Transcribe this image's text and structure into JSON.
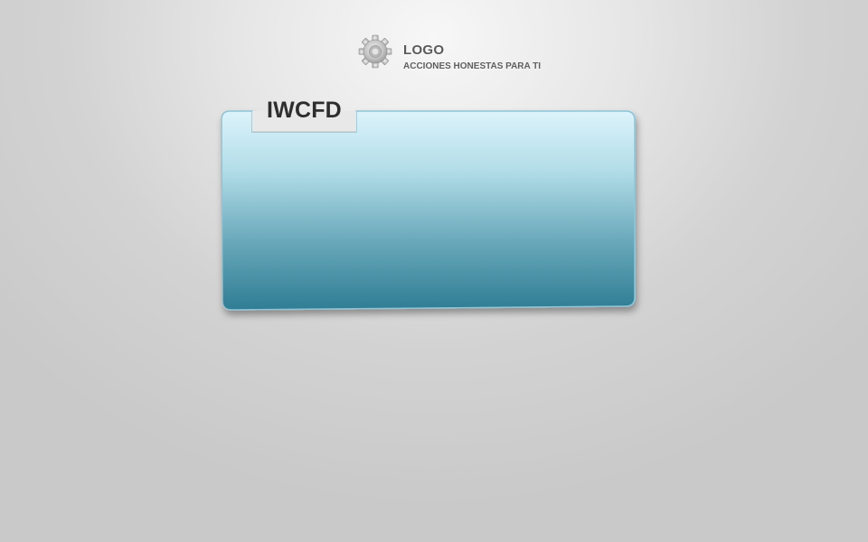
{
  "brand": {
    "logo_icon": "gear-icon",
    "title": "LOGO",
    "tagline": "ACCIONES HONESTAS PARA TI"
  },
  "panel": {
    "heading": "IWCFD",
    "colors": {
      "gradient_top": "#dcf3fb",
      "gradient_bottom": "#2f7d94",
      "border": "#8fc4d6"
    }
  }
}
